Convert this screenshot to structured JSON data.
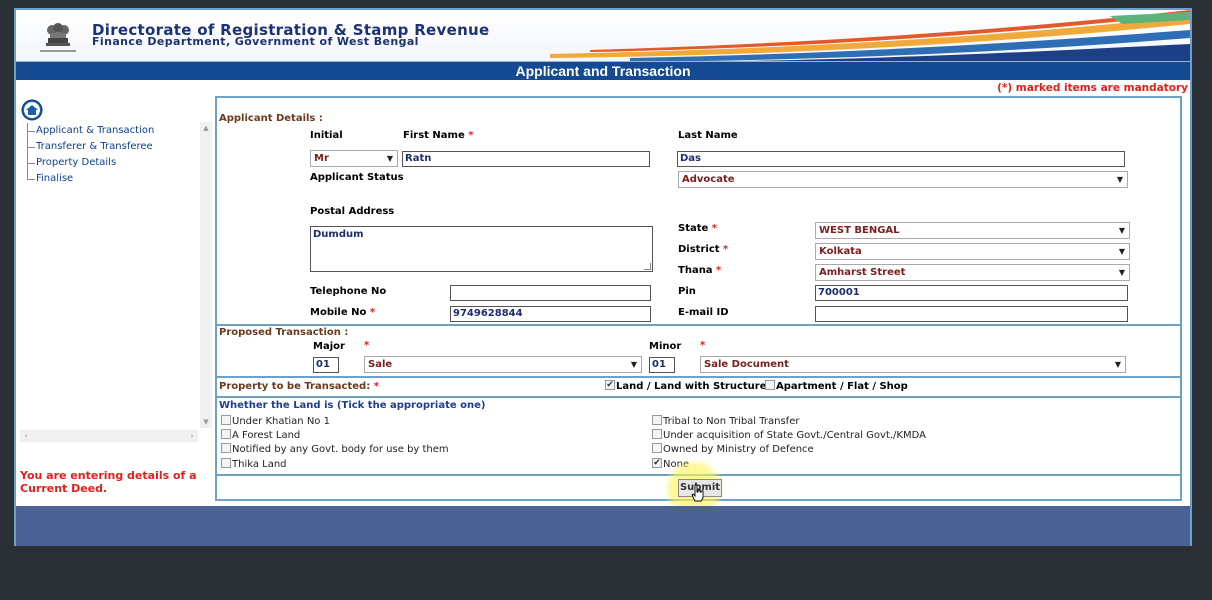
{
  "header": {
    "org_title": "Directorate of Registration & Stamp Revenue",
    "org_subtitle": "Finance Department, Government of West Bengal",
    "page_title": "Applicant and Transaction",
    "mandatory_note": "(*) marked items are mandatory"
  },
  "sidebar": {
    "items": [
      {
        "label": "Applicant & Transaction"
      },
      {
        "label": "Transferer & Transferee"
      },
      {
        "label": "Property Details"
      },
      {
        "label": "Finalise"
      }
    ],
    "notice": "You are entering details of a Current Deed."
  },
  "applicant": {
    "section_title": "Applicant Details :",
    "initial_label": "Initial",
    "initial_value": "Mr",
    "first_name_label": "First Name",
    "first_name_value": "Ratn",
    "last_name_label": "Last Name",
    "last_name_value": "Das",
    "status_label": "Applicant Status",
    "status_value": "Advocate",
    "postal_label": "Postal Address",
    "postal_value": "Dumdum",
    "state_label": "State",
    "state_value": "WEST BENGAL",
    "district_label": "District",
    "district_value": "Kolkata",
    "thana_label": "Thana",
    "thana_value": "Amharst Street",
    "telephone_label": "Telephone No",
    "telephone_value": "",
    "pin_label": "Pin",
    "pin_value": "700001",
    "mobile_label": "Mobile No",
    "mobile_value": "9749628844",
    "email_label": "E-mail ID",
    "email_value": ""
  },
  "transaction": {
    "section_title": "Proposed Transaction :",
    "major_label": "Major",
    "major_code": "01",
    "major_value": "Sale",
    "minor_label": "Minor",
    "minor_code": "01",
    "minor_value": "Sale Document"
  },
  "property": {
    "label": "Property to be Transacted:",
    "options": [
      {
        "label": "Land / Land with Structure",
        "checked": true
      },
      {
        "label": "Apartment / Flat / Shop",
        "checked": false
      }
    ]
  },
  "land": {
    "title": "Whether the Land is (Tick the appropriate one)",
    "left": [
      {
        "label": "Under Khatian No 1",
        "checked": false
      },
      {
        "label": "A Forest Land",
        "checked": false
      },
      {
        "label": "Notified by any Govt. body for use by them",
        "checked": false
      },
      {
        "label": "Thika Land",
        "checked": false
      }
    ],
    "right": [
      {
        "label": "Tribal to Non Tribal Transfer",
        "checked": false
      },
      {
        "label": "Under acquisition of State Govt./Central Govt./KMDA",
        "checked": false
      },
      {
        "label": "Owned by Ministry of Defence",
        "checked": false
      },
      {
        "label": "None",
        "checked": true
      }
    ]
  },
  "actions": {
    "submit_label": "Submit"
  },
  "colors": {
    "title_bar": "#134a92",
    "mandatory": "#e0201b",
    "border": "#6ea1c8",
    "footer": "#4a6294"
  }
}
